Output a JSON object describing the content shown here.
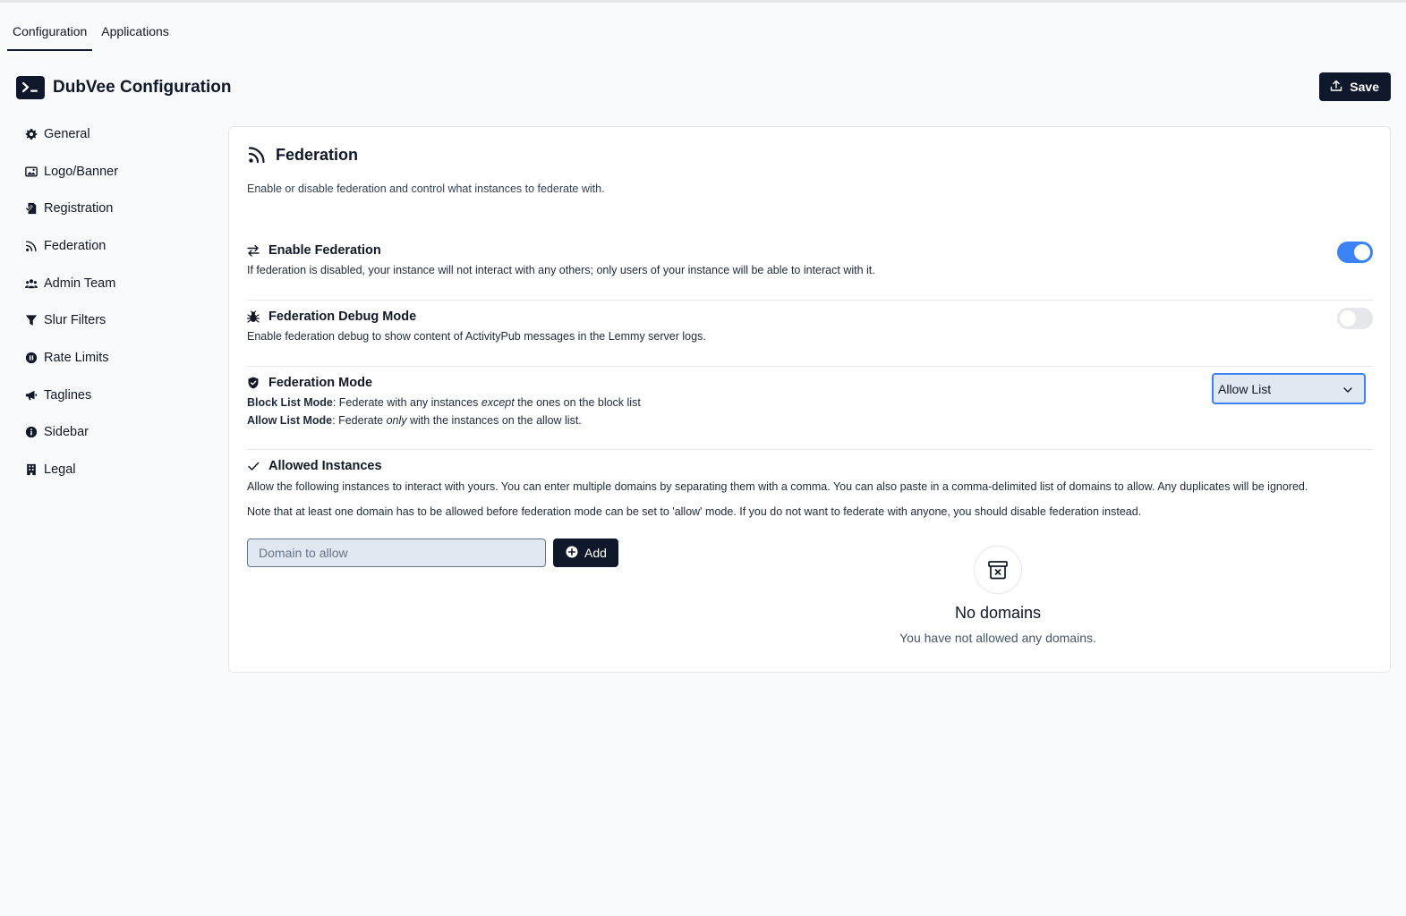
{
  "tabs": [
    {
      "label": "Configuration"
    },
    {
      "label": "Applications"
    }
  ],
  "header": {
    "title": "DubVee Configuration",
    "save_label": "Save"
  },
  "sidebar": {
    "items": [
      {
        "label": "General",
        "icon": "gear-icon"
      },
      {
        "label": "Logo/Banner",
        "icon": "image-icon"
      },
      {
        "label": "Registration",
        "icon": "document-check-icon"
      },
      {
        "label": "Federation",
        "icon": "rss-icon"
      },
      {
        "label": "Admin Team",
        "icon": "people-icon"
      },
      {
        "label": "Slur Filters",
        "icon": "funnel-icon"
      },
      {
        "label": "Rate Limits",
        "icon": "pause-circle-icon"
      },
      {
        "label": "Taglines",
        "icon": "megaphone-icon"
      },
      {
        "label": "Sidebar",
        "icon": "info-icon"
      },
      {
        "label": "Legal",
        "icon": "building-icon"
      }
    ]
  },
  "card": {
    "title": "Federation",
    "description": "Enable or disable federation and control what instances to federate with."
  },
  "enable_federation": {
    "title": "Enable Federation",
    "description": "If federation is disabled, your instance will not interact with any others; only users of your instance will be able to interact with it.",
    "enabled": true
  },
  "debug_mode": {
    "title": "Federation Debug Mode",
    "description": "Enable federation debug to show content of ActivityPub messages in the Lemmy server logs.",
    "enabled": false
  },
  "federation_mode": {
    "title": "Federation Mode",
    "block_label": "Block List Mode",
    "block_text_1": ": Federate with any instances ",
    "block_em": "except",
    "block_text_2": " the ones on the block list",
    "allow_label": "Allow List Mode",
    "allow_text_1": ": Federate ",
    "allow_em": "only",
    "allow_text_2": " with the instances on the allow list.",
    "selected": "Allow List"
  },
  "allowed_instances": {
    "title": "Allowed Instances",
    "description": "Allow the following instances to interact with yours. You can enter multiple domains by separating them with a comma. You can also paste in a comma-delimited list of domains to allow. Any duplicates will be ignored.",
    "note": "Note that at least one domain has to be allowed before federation mode can be set to 'allow' mode. If you do not want to federate with anyone, you should disable federation instead.",
    "input_placeholder": "Domain to allow",
    "input_value": "",
    "add_label": "Add",
    "empty_title": "No domains",
    "empty_desc": "You have not allowed any domains."
  },
  "colors": {
    "primary": "#0f172a",
    "accent": "#3b82f6",
    "background": "#f8fafc"
  }
}
